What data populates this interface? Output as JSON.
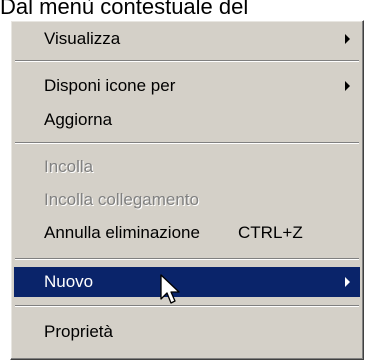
{
  "header": {
    "caption": "Dal menù contestuale del"
  },
  "context_menu": {
    "items": [
      {
        "label": "Visualizza",
        "submenu": true
      },
      {
        "label": "Disponi icone per",
        "submenu": true
      },
      {
        "label": "Aggiorna"
      },
      {
        "label": "Incolla",
        "disabled": true
      },
      {
        "label": "Incolla collegamento",
        "disabled": true
      },
      {
        "label": "Annulla eliminazione",
        "shortcut": "CTRL+Z"
      },
      {
        "label": "Nuovo",
        "submenu": true,
        "highlighted": true
      },
      {
        "label": "Proprietà"
      }
    ]
  },
  "colors": {
    "menu_background": "#d4d0c8",
    "highlight": "#0a246a",
    "disabled_text": "#808080"
  },
  "icons": {
    "cursor": "arrow-cursor-icon",
    "submenu": "submenu-arrow-icon"
  }
}
